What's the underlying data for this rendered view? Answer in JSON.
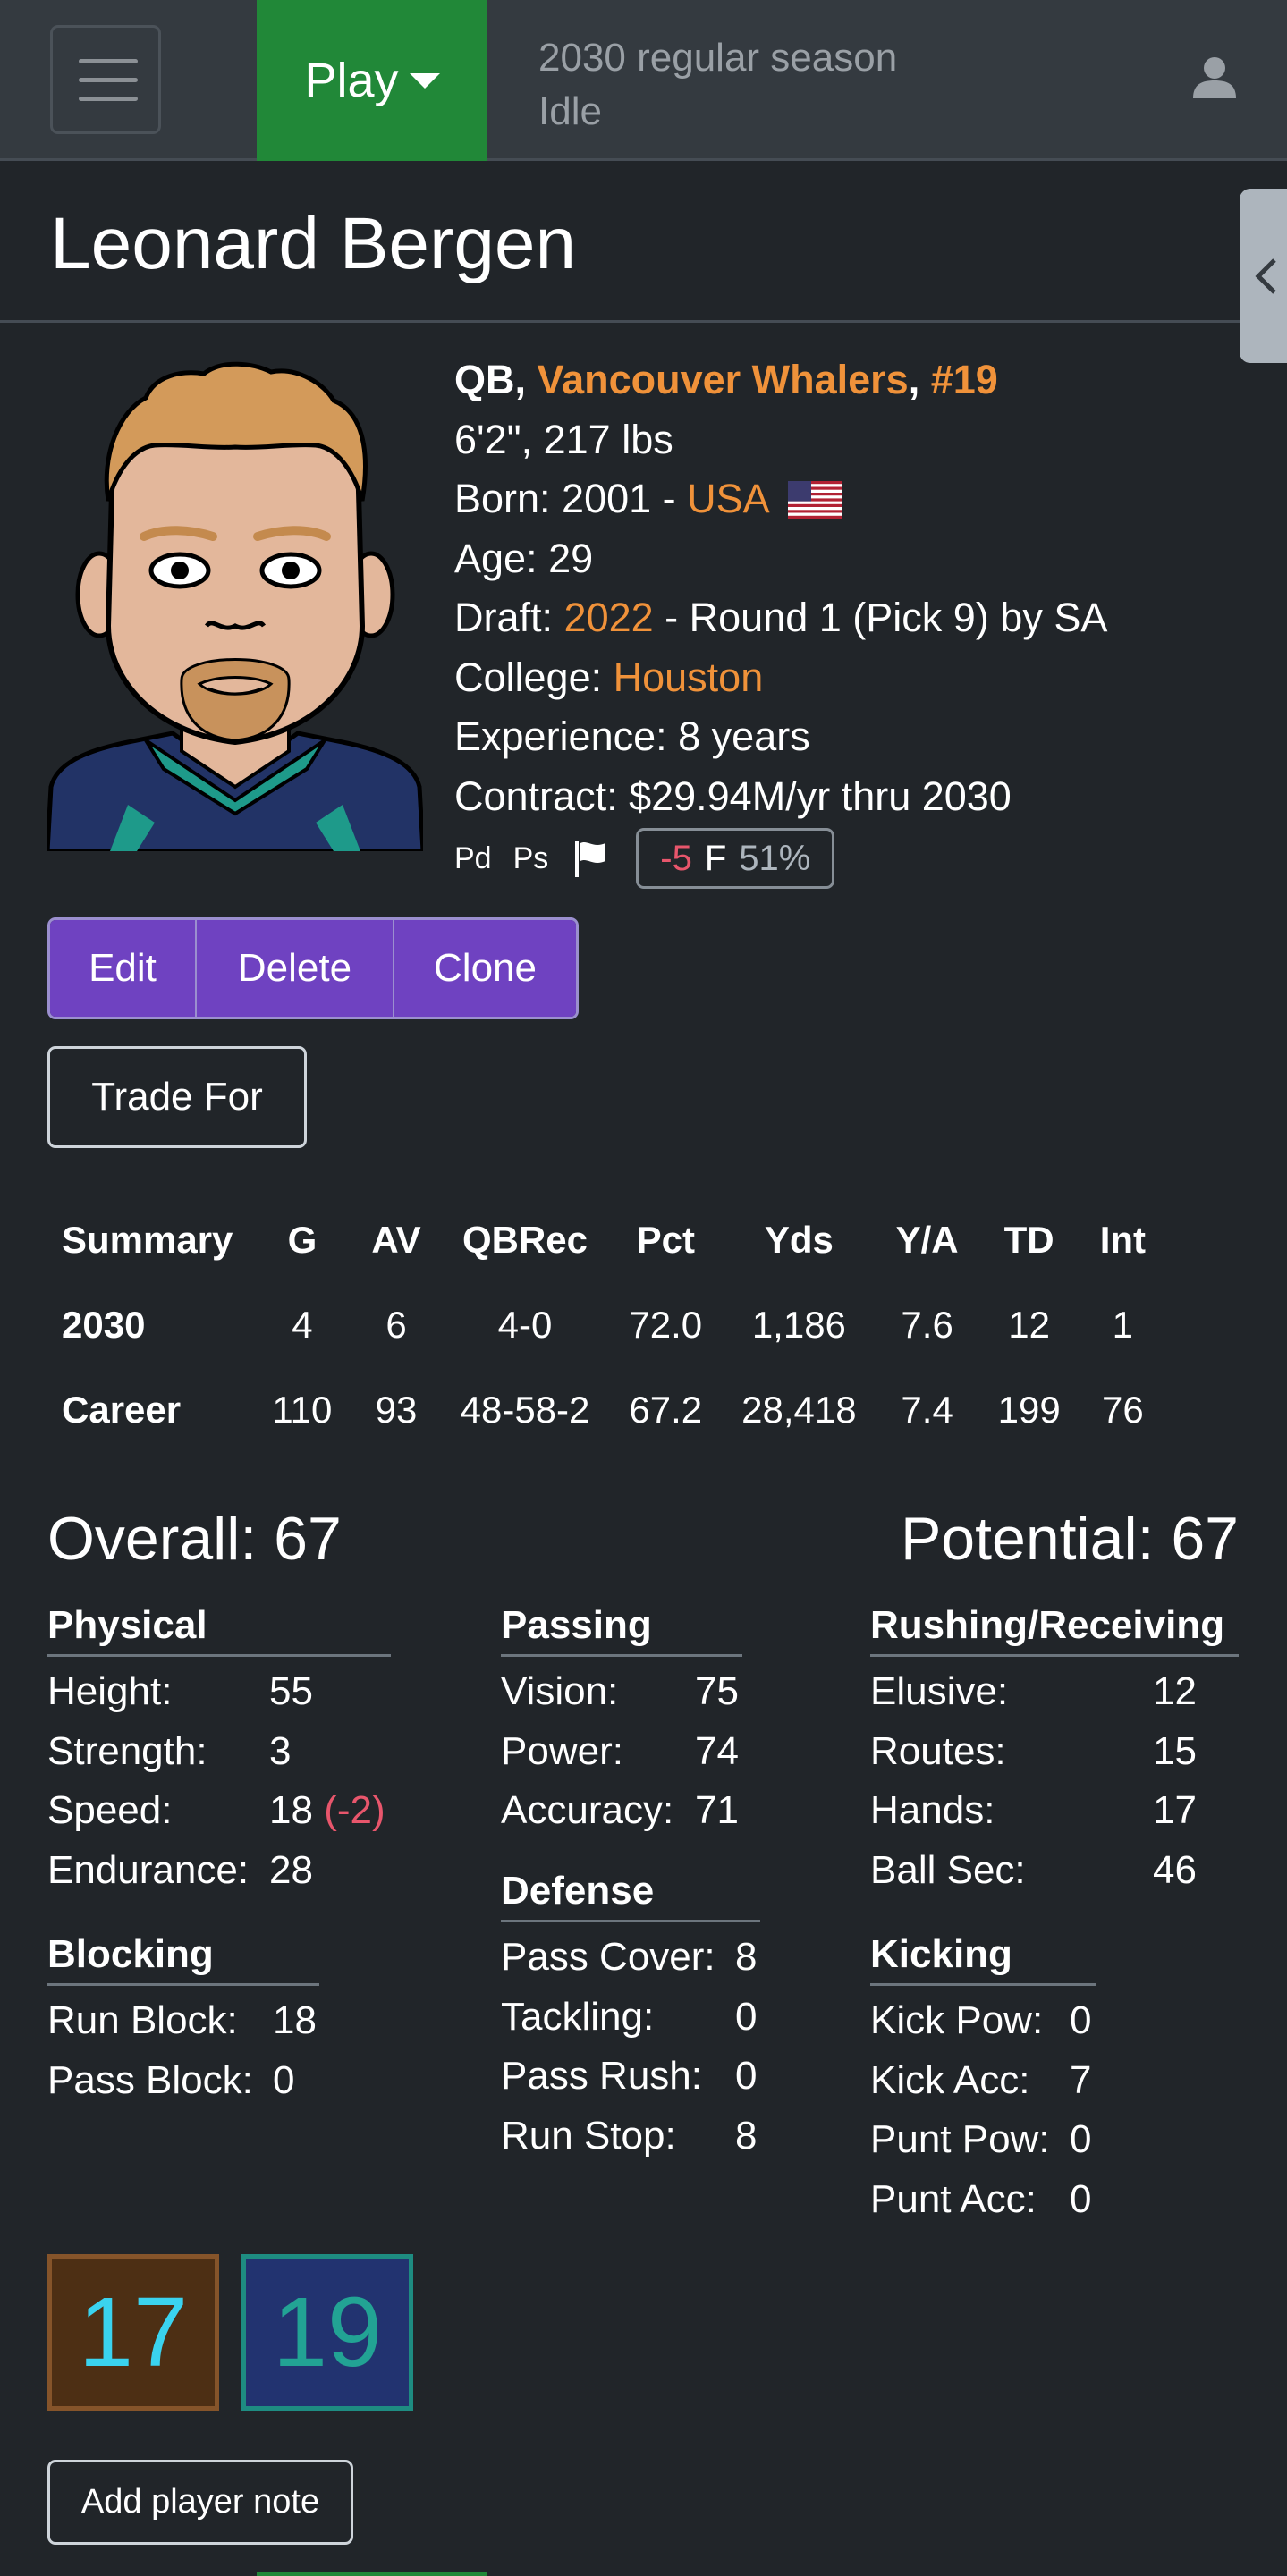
{
  "navbar": {
    "play_label": "Play",
    "season_line1": "2030 regular season",
    "season_line2": "Idle"
  },
  "player": {
    "name": "Leonard Bergen",
    "position": "QB,",
    "team": "Vancouver Whalers",
    "comma": ",",
    "number": "#19",
    "height_weight": "6'2\", 217 lbs",
    "born_prefix": "Born: 2001 -",
    "born_country": "USA",
    "age": "Age: 29",
    "draft_prefix": "Draft:",
    "draft_year": "2022",
    "draft_suffix": "- Round 1 (Pick 9) by SA",
    "college_prefix": "College:",
    "college": "Houston",
    "experience": "Experience: 8 years",
    "contract": "Contract: $29.94M/yr thru 2030"
  },
  "mini": {
    "pd": "Pd",
    "ps": "Ps",
    "skill_delta": "-5",
    "skill_grade": "F",
    "skill_pct": "51%"
  },
  "actions": {
    "edit": "Edit",
    "delete": "Delete",
    "clone": "Clone",
    "trade": "Trade For",
    "note": "Add player note"
  },
  "stats": {
    "headers": [
      "Summary",
      "G",
      "AV",
      "QBRec",
      "Pct",
      "Yds",
      "Y/A",
      "TD",
      "Int"
    ],
    "rows": [
      [
        "2030",
        "4",
        "6",
        "4-0",
        "72.0",
        "1,186",
        "7.6",
        "12",
        "1"
      ],
      [
        "Career",
        "110",
        "93",
        "48-58-2",
        "67.2",
        "28,418",
        "7.4",
        "199",
        "76"
      ]
    ]
  },
  "ratings": {
    "overall": "Overall: 67",
    "potential": "Potential: 67",
    "physical": {
      "title": "Physical",
      "items": [
        {
          "label": "Height:",
          "value": "55",
          "delta": ""
        },
        {
          "label": "Strength:",
          "value": "3",
          "delta": ""
        },
        {
          "label": "Speed:",
          "value": "18",
          "delta": "(-2)"
        },
        {
          "label": "Endurance:",
          "value": "28",
          "delta": ""
        }
      ]
    },
    "blocking": {
      "title": "Blocking",
      "items": [
        {
          "label": "Run Block:",
          "value": "18"
        },
        {
          "label": "Pass Block:",
          "value": "0"
        }
      ]
    },
    "passing": {
      "title": "Passing",
      "items": [
        {
          "label": "Vision:",
          "value": "75"
        },
        {
          "label": "Power:",
          "value": "74"
        },
        {
          "label": "Accuracy:",
          "value": "71"
        }
      ]
    },
    "defense": {
      "title": "Defense",
      "items": [
        {
          "label": "Pass Cover:",
          "value": "8"
        },
        {
          "label": "Tackling:",
          "value": "0"
        },
        {
          "label": "Pass Rush:",
          "value": "0"
        },
        {
          "label": "Run Stop:",
          "value": "8"
        }
      ]
    },
    "rushing": {
      "title": "Rushing/Receiving",
      "items": [
        {
          "label": "Elusive:",
          "value": "12"
        },
        {
          "label": "Routes:",
          "value": "15"
        },
        {
          "label": "Hands:",
          "value": "17"
        },
        {
          "label": "Ball Sec:",
          "value": "46"
        }
      ]
    },
    "kicking": {
      "title": "Kicking",
      "items": [
        {
          "label": "Kick Pow:",
          "value": "0"
        },
        {
          "label": "Kick Acc:",
          "value": "7"
        },
        {
          "label": "Punt Pow:",
          "value": "0"
        },
        {
          "label": "Punt Acc:",
          "value": "0"
        }
      ]
    }
  },
  "jerseys": {
    "brown_number": "17",
    "navy_number": "19"
  },
  "icons": {
    "menu": "hamburger-icon",
    "dropdown": "caret-down-icon",
    "user": "user-icon",
    "collapse": "chevron-left-icon",
    "flag": "us-flag-icon",
    "injury_flag": "flag-icon"
  },
  "colors": {
    "accent_orange": "#f0923a",
    "play_green": "#218838",
    "button_purple": "#6f42c1",
    "negative_red": "#e8566c"
  }
}
